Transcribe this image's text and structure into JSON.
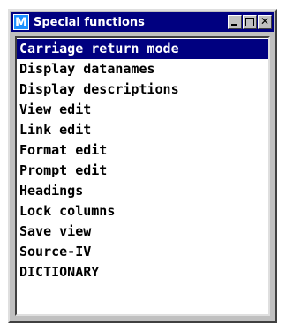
{
  "window": {
    "title": "Special functions",
    "icon_letter": "M",
    "icon": "app-m-icon",
    "controls": {
      "minimize": "minimize-icon",
      "maximize": "maximize-icon",
      "close": "close-icon",
      "close_glyph": "✕"
    }
  },
  "colors": {
    "titlebar": "#000080",
    "selection": "#000080",
    "icon_bg": "#1e90ff",
    "frame": "#c0c0c0"
  },
  "list": {
    "selected_index": 0,
    "items": [
      "Carriage return mode",
      "Display datanames",
      "Display descriptions",
      "View edit",
      "Link edit",
      "Format edit",
      "Prompt edit",
      "Headings",
      "Lock columns",
      "Save view",
      "Source-IV",
      "DICTIONARY"
    ]
  }
}
